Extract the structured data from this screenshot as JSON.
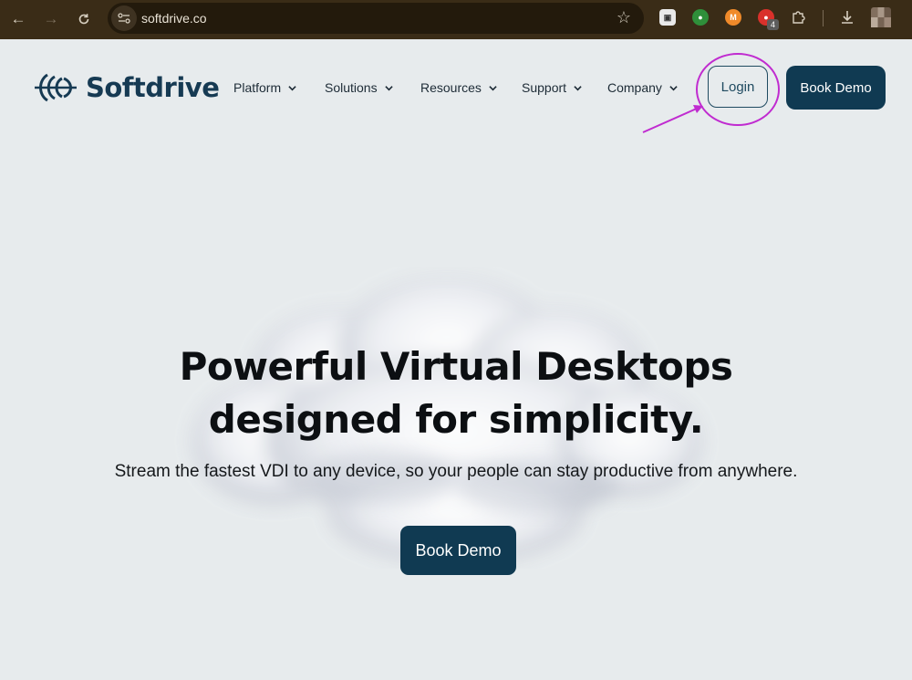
{
  "browser": {
    "url": "softdrive.co",
    "extension_badge": "4"
  },
  "site": {
    "brand": "Softdrive",
    "nav": [
      {
        "label": "Platform"
      },
      {
        "label": "Solutions"
      },
      {
        "label": "Resources"
      },
      {
        "label": "Support"
      },
      {
        "label": "Company"
      }
    ],
    "login_label": "Login",
    "book_demo_label": "Book Demo"
  },
  "hero": {
    "title_line1": "Powerful Virtual Desktops",
    "title_line2": "designed for simplicity.",
    "subtitle": "Stream the fastest VDI to any device, so your people can stay productive from anywhere.",
    "cta_label": "Book Demo"
  },
  "colors": {
    "brand_navy": "#103a52",
    "annotation": "#c02bd0"
  }
}
